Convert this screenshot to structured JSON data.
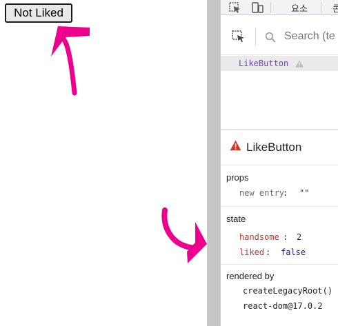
{
  "page": {
    "like_button_label": "Not Liked"
  },
  "colors": {
    "annotation_arrow": "#ec008c",
    "divider": "#c6c6c6",
    "component_name": "#6f42c1",
    "warning": "#d93025",
    "state_key": "#c6392b",
    "value": "#1e1e96"
  },
  "devtools": {
    "toolbar": {
      "icons": [
        "inspect-element-icon",
        "device-toolbar-icon"
      ],
      "tabs": [
        "요소",
        "콘"
      ]
    },
    "search": {
      "placeholder": "Search (te"
    },
    "tree": {
      "selected_component": "LikeButton"
    },
    "component": {
      "name": "LikeButton",
      "props_title": "props",
      "props": [
        {
          "key": "new entry",
          "value": "\"\""
        }
      ],
      "state_title": "state",
      "state": [
        {
          "key": "handsome",
          "value": "2"
        },
        {
          "key": "liked",
          "value": "false"
        }
      ],
      "rendered_by_title": "rendered by",
      "rendered_by": [
        "createLegacyRoot()",
        "react-dom@17.0.2"
      ]
    }
  }
}
